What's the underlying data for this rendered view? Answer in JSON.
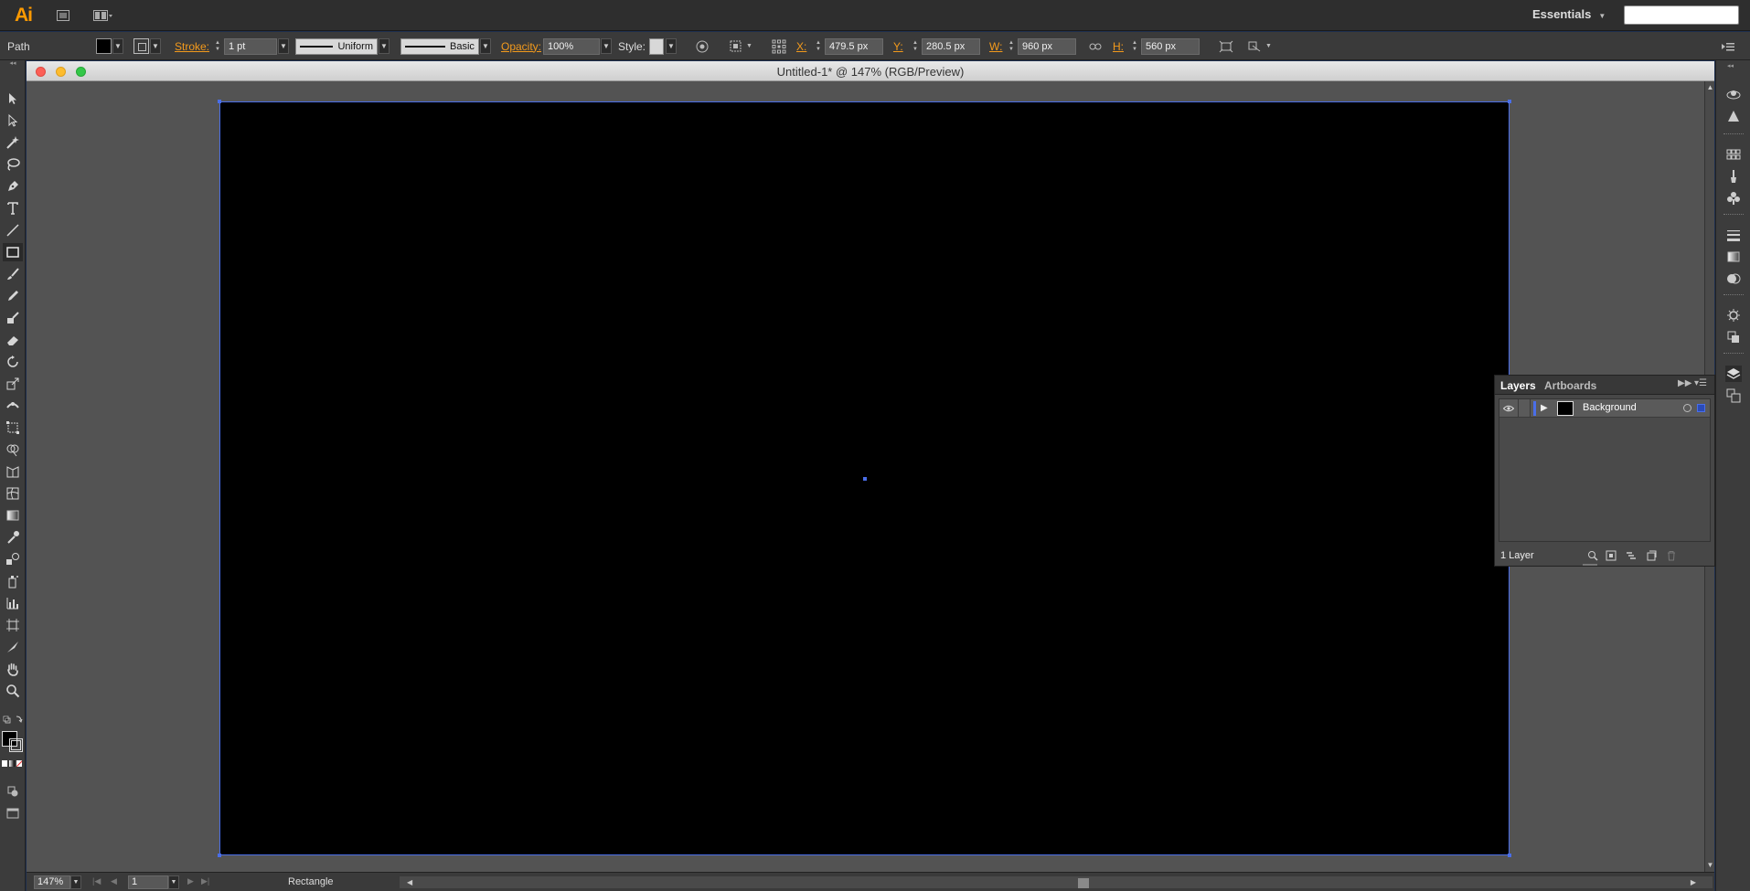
{
  "app": {
    "logo": "Ai",
    "workspace": "Essentials",
    "search_placeholder": ""
  },
  "control_bar": {
    "selection_type": "Path",
    "stroke_label": "Stroke:",
    "stroke_weight": "1 pt",
    "variable_width": "Uniform",
    "brush": "Basic",
    "opacity_label": "Opacity:",
    "opacity": "100%",
    "style_label": "Style:",
    "x_label": "X:",
    "x_value": "479.5 px",
    "y_label": "Y:",
    "y_value": "280.5 px",
    "w_label": "W:",
    "w_value": "960 px",
    "h_label": "H:",
    "h_value": "560 px",
    "fill_color": "#000000"
  },
  "document": {
    "title": "Untitled-1* @ 147% (RGB/Preview)",
    "artboard_fill": "#000000",
    "selection_color": "#4a6ee8"
  },
  "status_bar": {
    "zoom": "147%",
    "artboard_number": "1",
    "status": "Rectangle"
  },
  "layers_panel": {
    "tabs": [
      "Layers",
      "Artboards"
    ],
    "layers": [
      {
        "name": "Background",
        "visible": true,
        "color": "#4a6ee8"
      }
    ],
    "count": "1 Layer"
  },
  "toolbar": {
    "tools": [
      "selection-tool",
      "direct-selection-tool",
      "magic-wand-tool",
      "lasso-tool",
      "pen-tool",
      "type-tool",
      "line-segment-tool",
      "rectangle-tool",
      "paintbrush-tool",
      "pencil-tool",
      "blob-brush-tool",
      "eraser-tool",
      "rotate-tool",
      "scale-tool",
      "width-tool",
      "free-transform-tool",
      "shape-builder-tool",
      "perspective-grid-tool",
      "mesh-tool",
      "gradient-tool",
      "eyedropper-tool",
      "blend-tool",
      "symbol-sprayer-tool",
      "column-graph-tool",
      "artboard-tool",
      "slice-tool",
      "hand-tool",
      "zoom-tool"
    ]
  },
  "right_dock": {
    "icons": [
      "color-guide-icon",
      "color-icon",
      "swatches-icon",
      "brushes-icon",
      "symbols-icon",
      "stroke-icon",
      "gradient-icon",
      "transparency-icon",
      "appearance-icon",
      "graphic-styles-icon",
      "layers-icon",
      "artboards-icon"
    ]
  }
}
